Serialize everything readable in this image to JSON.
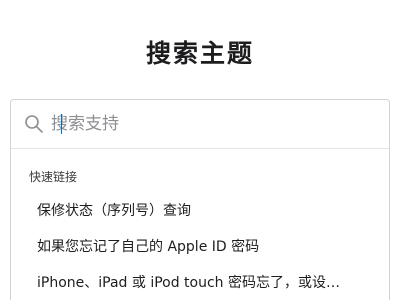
{
  "header": {
    "title": "搜索主题"
  },
  "search": {
    "placeholder": "搜索支持",
    "icon": "search-icon"
  },
  "quick_links": {
    "heading": "快速链接",
    "items": [
      {
        "label": "保修状态（序列号）查询"
      },
      {
        "label": "如果您忘记了自己的 Apple ID 密码"
      },
      {
        "label": "iPhone、iPad 或 iPod touch 密码忘了，或设…"
      }
    ]
  },
  "colors": {
    "text": "#1d1d1f",
    "border": "#d2d2d7",
    "placeholder": "#8e8e93",
    "caret": "#0070c9"
  }
}
